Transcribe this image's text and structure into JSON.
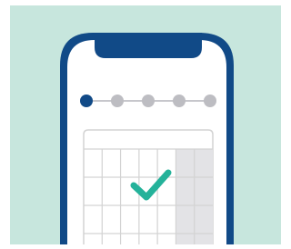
{
  "illustration": {
    "progress": {
      "total_steps": 5,
      "active_step": 1
    },
    "calendar": {
      "checked_cell_icon": "checkmark-icon",
      "shaded_column_present": true
    },
    "colors": {
      "background_mint": "#c7e6dd",
      "phone_frame_navy": "#114a87",
      "screen_white": "#ffffff",
      "dot_active_navy": "#114a87",
      "dot_inactive_gray": "#bdbdc2",
      "connector_gray": "#c7c7cc",
      "grid_line_gray": "#d3d3d3",
      "shaded_column_gray": "#e3e3e6",
      "check_teal": "#24b29a"
    }
  }
}
